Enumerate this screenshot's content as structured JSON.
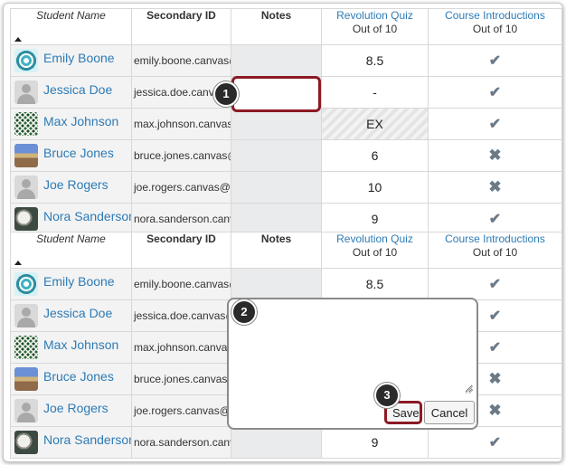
{
  "columns": {
    "student_name": "Student Name",
    "secondary_id": "Secondary ID",
    "notes": "Notes",
    "quiz_title": "Revolution Quiz",
    "quiz_sub": "Out of 10",
    "course_title": "Course Introductions",
    "course_sub": "Out of 10"
  },
  "students": [
    {
      "name": "Emily Boone",
      "secondary_id": "emily.boone.canvas@",
      "quiz": "8.5",
      "course": "check",
      "avatar": "teal-pattern"
    },
    {
      "name": "Jessica Doe",
      "secondary_id": "jessica.doe.canvas@",
      "quiz": "-",
      "course": "check",
      "avatar": "default-user"
    },
    {
      "name": "Max Johnson",
      "secondary_id": "max.johnson.canvas@",
      "quiz": "EX",
      "course": "check",
      "avatar": "green-pattern"
    },
    {
      "name": "Bruce Jones",
      "secondary_id": "bruce.jones.canvas@",
      "quiz": "6",
      "course": "cross",
      "avatar": "beach-photo"
    },
    {
      "name": "Joe Rogers",
      "secondary_id": "joe.rogers.canvas@gr",
      "quiz": "10",
      "course": "cross",
      "avatar": "default-user"
    },
    {
      "name": "Nora Sanderson",
      "secondary_id": "nora.sanderson.canv",
      "quiz": "9",
      "course": "check",
      "avatar": "sheep-photo"
    }
  ],
  "annotations": {
    "step1": "1",
    "step2": "2",
    "step3": "3"
  },
  "popup": {
    "notes_value": "",
    "save_label": "Save",
    "cancel_label": "Cancel"
  },
  "icons": {
    "check": "✔",
    "cross": "✖"
  },
  "colors": {
    "link": "#2d7bb6",
    "highlight": "#8b1a24",
    "badge": "#2a2a2a"
  }
}
